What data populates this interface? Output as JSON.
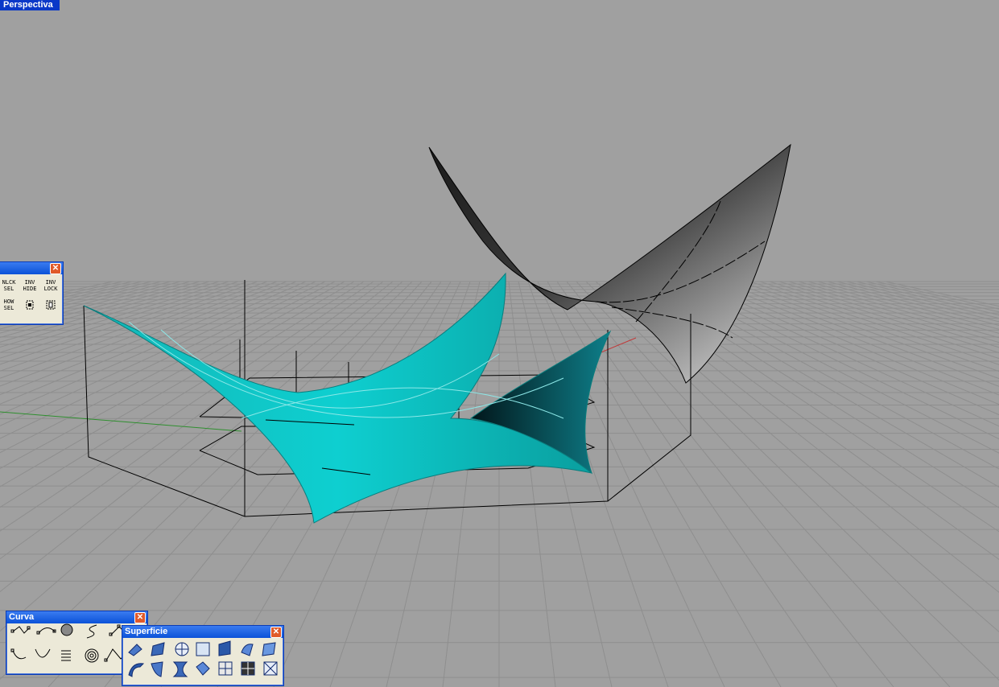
{
  "viewport": {
    "label": "Perspectiva"
  },
  "select_toolbar": {
    "row1": [
      "NLCK SEL",
      "INV HIDE",
      "INV LOCK"
    ],
    "row2": [
      "HOW SEL"
    ]
  },
  "curve_toolbar": {
    "title": "Curva"
  },
  "surface_toolbar": {
    "title": "Superficie"
  },
  "close_glyph": "✕",
  "colors": {
    "background": "#a0a0a0",
    "grid": "#8e8e8e",
    "surface": "#11c4c4",
    "title_blue": "#0a38c8"
  }
}
